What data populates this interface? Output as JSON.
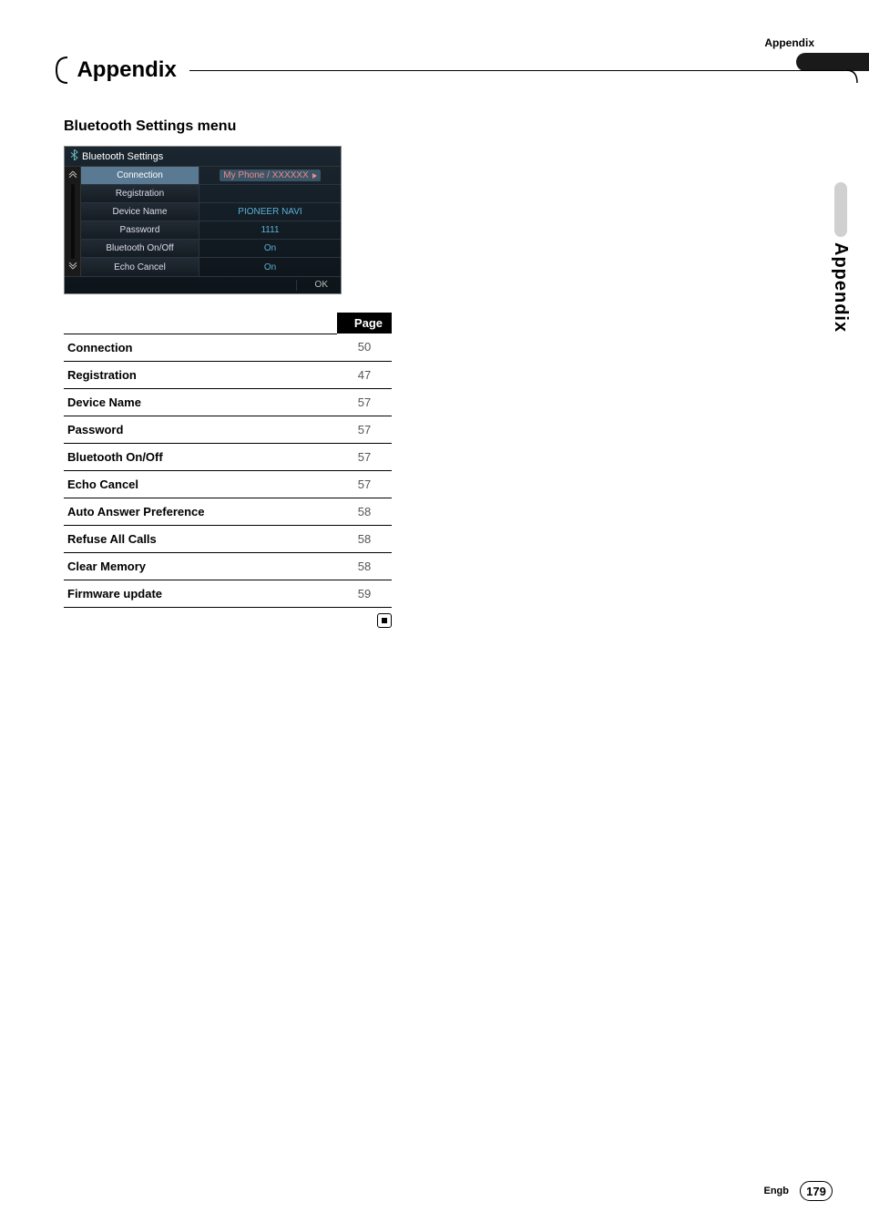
{
  "header": {
    "section_label": "Appendix",
    "title": "Appendix"
  },
  "side_tab": {
    "label": "Appendix"
  },
  "subsection": {
    "title_part1": "Bluetooth Settings",
    "title_part2": " menu"
  },
  "settings_screen": {
    "title": "Bluetooth Settings",
    "rows": [
      {
        "label": "Connection",
        "value": "My Phone / XXXXXX",
        "value_style": "orange",
        "selected": true,
        "has_play": true
      },
      {
        "label": "Registration",
        "value": "",
        "value_style": "",
        "selected": false,
        "has_play": false
      },
      {
        "label": "Device Name",
        "value": "PIONEER NAVI",
        "value_style": "cyan",
        "selected": false,
        "has_play": false
      },
      {
        "label": "Password",
        "value": "1111",
        "value_style": "cyan",
        "selected": false,
        "has_play": false
      },
      {
        "label": "Bluetooth On/Off",
        "value": "On",
        "value_style": "cyan",
        "selected": false,
        "has_play": false
      },
      {
        "label": "Echo Cancel",
        "value": "On",
        "value_style": "cyan",
        "selected": false,
        "has_play": false
      }
    ],
    "ok_button": "OK"
  },
  "index_table": {
    "page_header": "Page",
    "rows": [
      {
        "item": "Connection",
        "page": "50"
      },
      {
        "item": "Registration",
        "page": "47"
      },
      {
        "item": "Device Name",
        "page": "57"
      },
      {
        "item": "Password",
        "page": "57"
      },
      {
        "item": "Bluetooth On/Off",
        "page": "57"
      },
      {
        "item": "Echo Cancel",
        "page": "57"
      },
      {
        "item": "Auto Answer Preference",
        "page": "58"
      },
      {
        "item": "Refuse All Calls",
        "page": "58"
      },
      {
        "item": "Clear Memory",
        "page": "58"
      },
      {
        "item": "Firmware update",
        "page": "59"
      }
    ]
  },
  "footer": {
    "lang": "Engb",
    "page_number": "179"
  }
}
